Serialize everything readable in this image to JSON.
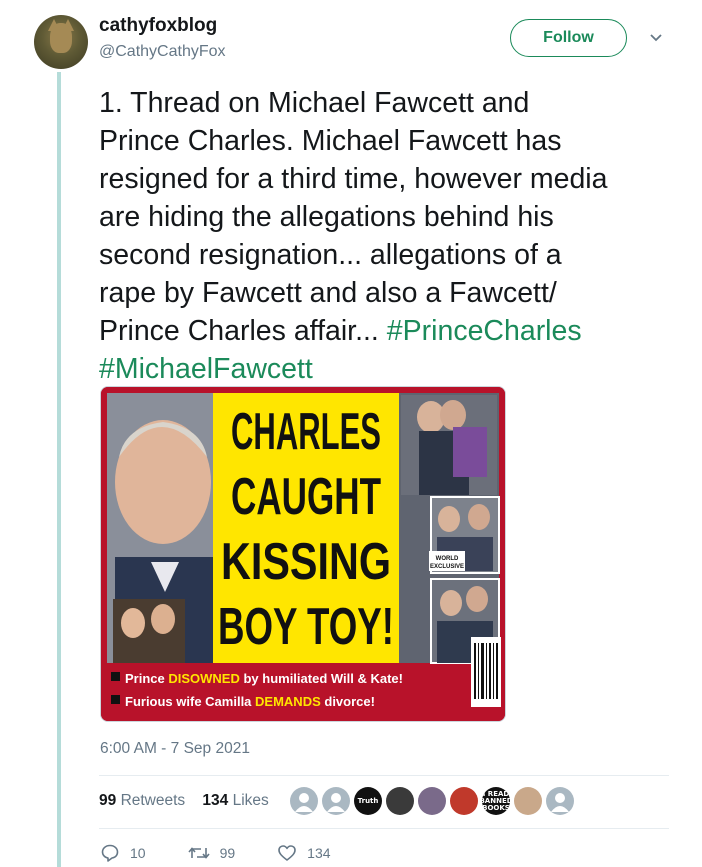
{
  "author": {
    "display_name": "cathyfoxblog",
    "handle": "@CathyCathyFox",
    "avatar_icon": "fox-avatar"
  },
  "follow_label": "Follow",
  "tweet": {
    "text_lines": [
      "1. Thread on Michael Fawcett and",
      "Prince Charles. Michael Fawcett has",
      "resigned for a third time, however media",
      "are hiding the allegations behind his",
      "second resignation... allegations of a",
      "rape by Fawcett and also a Fawcett/",
      "Prince Charles affair..."
    ],
    "hashtag1": "#PrinceCharles",
    "hashtag2": "#MichaelFawcett"
  },
  "media": {
    "headline": [
      "CHARLES",
      "CAUGHT",
      "KISSING",
      "BOY TOY!"
    ],
    "badge": [
      "WORLD",
      "EXCLUSIVE"
    ],
    "caption1_pre": "Prince ",
    "caption1_highlight": "DISOWNED",
    "caption1_post": " by humiliated Will & Kate!",
    "caption2_pre": "Furious wife Camilla ",
    "caption2_highlight": "DEMANDS",
    "caption2_post": " divorce!",
    "colors": {
      "background": "#b8122a",
      "headline": "#ffe600",
      "caption_bar": "#b8122a"
    }
  },
  "timestamp": "6:00 AM - 7 Sep 2021",
  "stats": {
    "retweets_count": "99",
    "retweets_label": "Retweets",
    "likes_count": "134",
    "likes_label": "Likes"
  },
  "likers": [
    {
      "icon": "default-avatar",
      "color": "#aab8c2",
      "label": ""
    },
    {
      "icon": "default-avatar",
      "color": "#aab8c2",
      "label": ""
    },
    {
      "icon": "truth-avatar",
      "color": "#111111",
      "label": "Truth"
    },
    {
      "icon": "photo-avatar",
      "color": "#3a3a3a",
      "label": ""
    },
    {
      "icon": "face-avatar",
      "color": "#7a6a8a",
      "label": ""
    },
    {
      "icon": "fist-avatar",
      "color": "#c0392b",
      "label": ""
    },
    {
      "icon": "read-banned-books-avatar",
      "color": "#111111",
      "label": "I READ BANNED BOOKS"
    },
    {
      "icon": "photo-avatar",
      "color": "#c9a88a",
      "label": ""
    },
    {
      "icon": "default-avatar",
      "color": "#aab8c2",
      "label": ""
    }
  ],
  "actions": {
    "reply_count": "10",
    "retweet_count": "99",
    "like_count": "134"
  },
  "colors": {
    "accent": "#1b8a5a",
    "thread_line": "#b5dcd9",
    "secondary_text": "#657786"
  }
}
